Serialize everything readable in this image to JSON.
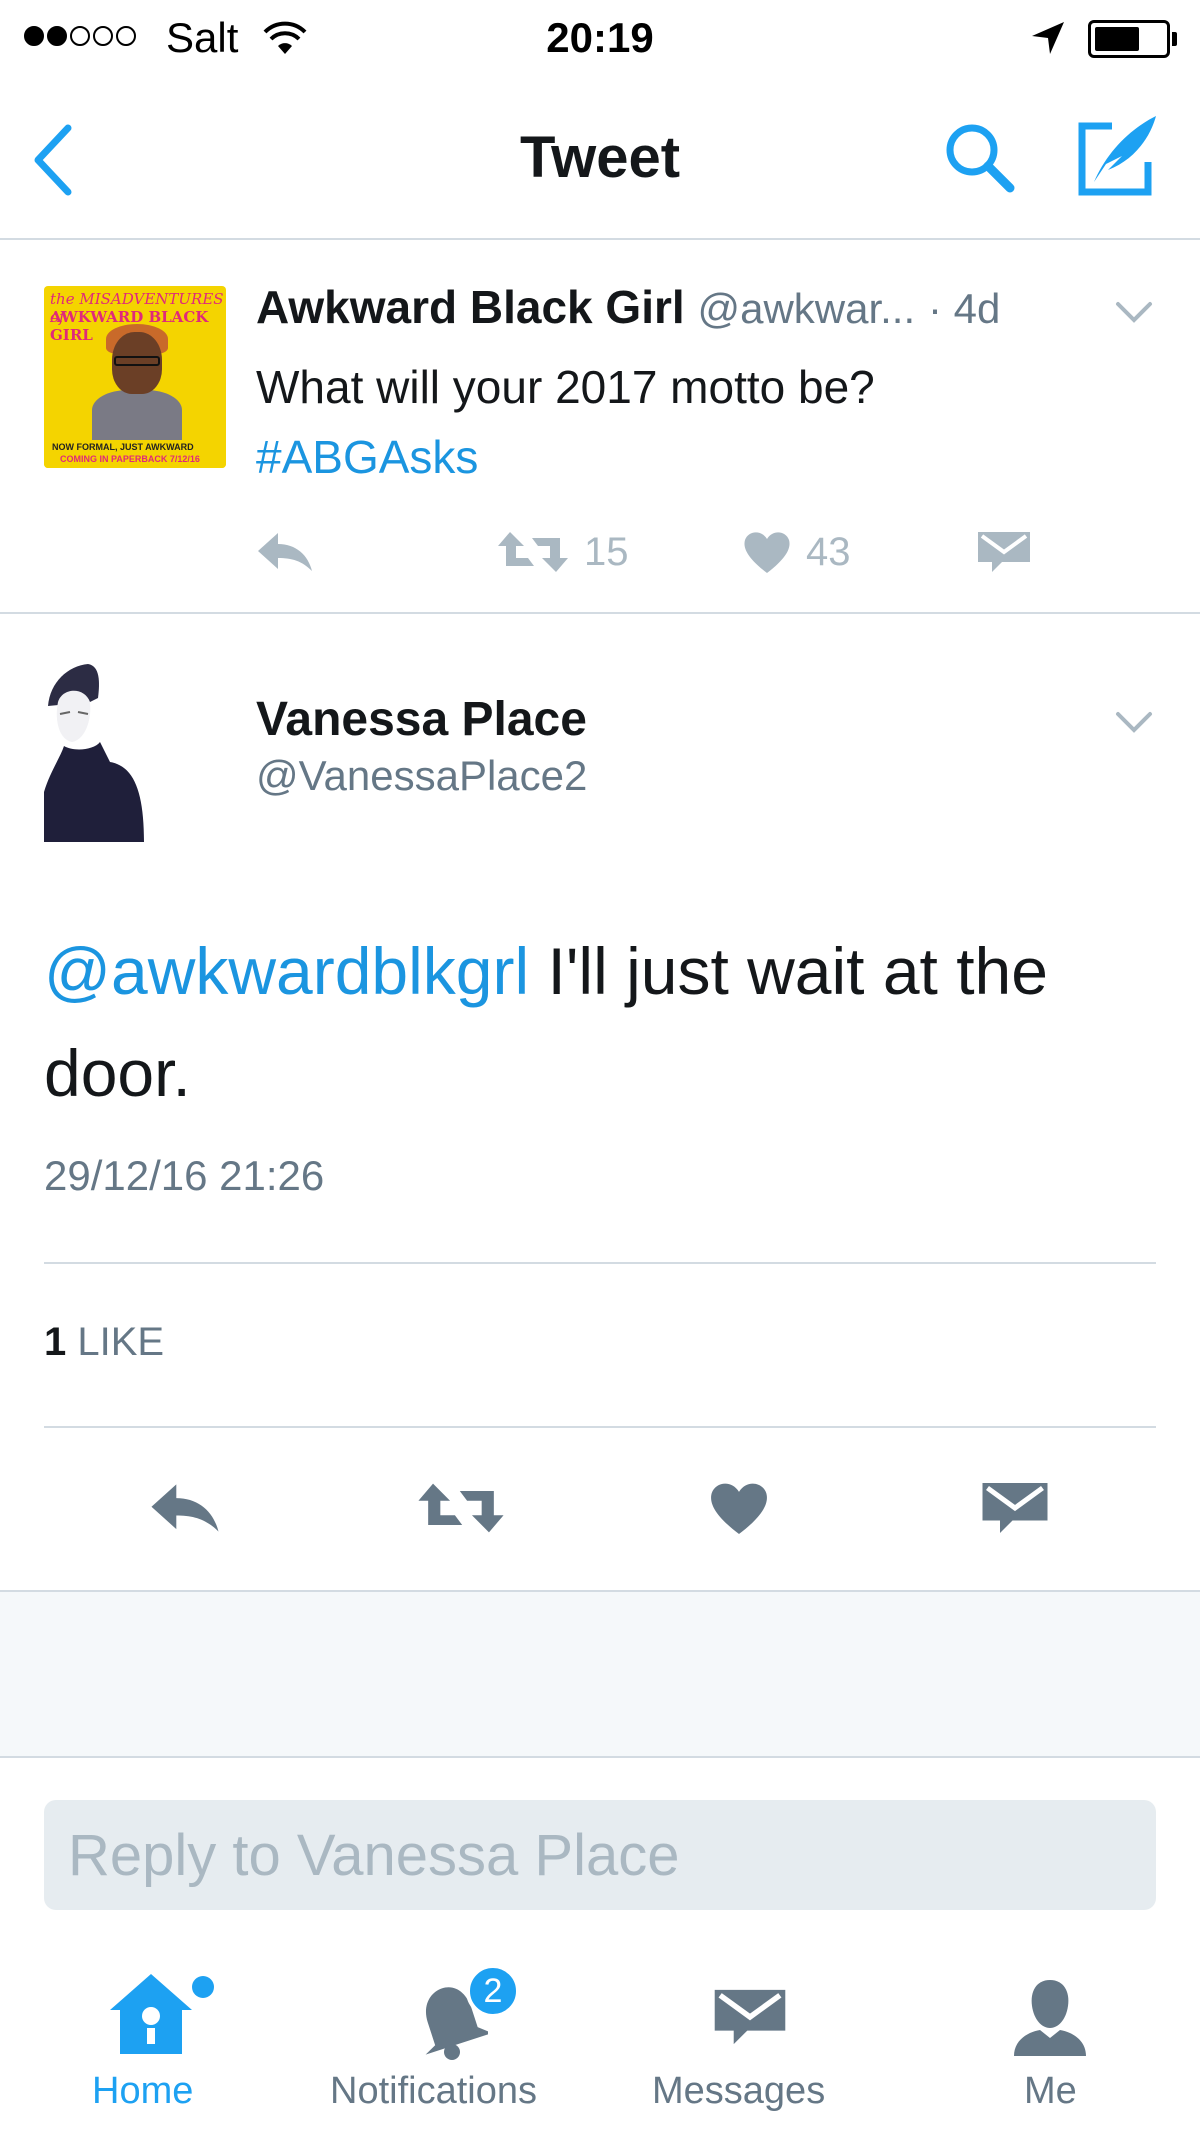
{
  "status_bar": {
    "carrier": "Salt",
    "time": "20:19"
  },
  "nav": {
    "title": "Tweet"
  },
  "parent_tweet": {
    "avatar_text": {
      "line1": "the MISADVENTURES of",
      "line2": "AWKWARD BLACK GIRL",
      "caption1": "NOW FORMAL, JUST AWKWARD",
      "caption2": "COMING IN PAPERBACK 7/12/16"
    },
    "name": "Awkward Black Girl",
    "handle": "@awkwar...",
    "age": "· 4d",
    "text": "What will your 2017 motto be?",
    "hashtag": "#ABGAsks",
    "retweets": "15",
    "likes": "43"
  },
  "main_tweet": {
    "name": "Vanessa Place",
    "handle": "@VanessaPlace2",
    "mention": "@awkwardblkgrl",
    "text": " I'll just wait at the door.",
    "timestamp": "29/12/16 21:26",
    "like_count": "1",
    "like_label": "LIKE"
  },
  "reply": {
    "placeholder": "Reply to Vanessa Place"
  },
  "tab_bar": {
    "home": "Home",
    "notifications": "Notifications",
    "notifications_badge": "2",
    "messages": "Messages",
    "me": "Me"
  },
  "colors": {
    "accent": "#1da1f2",
    "link": "#1b95e0",
    "icon_gray": "#657786",
    "muted": "#aab8c2"
  },
  "icons": [
    "back-chevron-icon",
    "search-icon",
    "compose-icon",
    "reply-icon",
    "retweet-icon",
    "heart-icon",
    "message-icon",
    "home-icon",
    "bell-icon",
    "envelope-icon",
    "person-icon"
  ]
}
